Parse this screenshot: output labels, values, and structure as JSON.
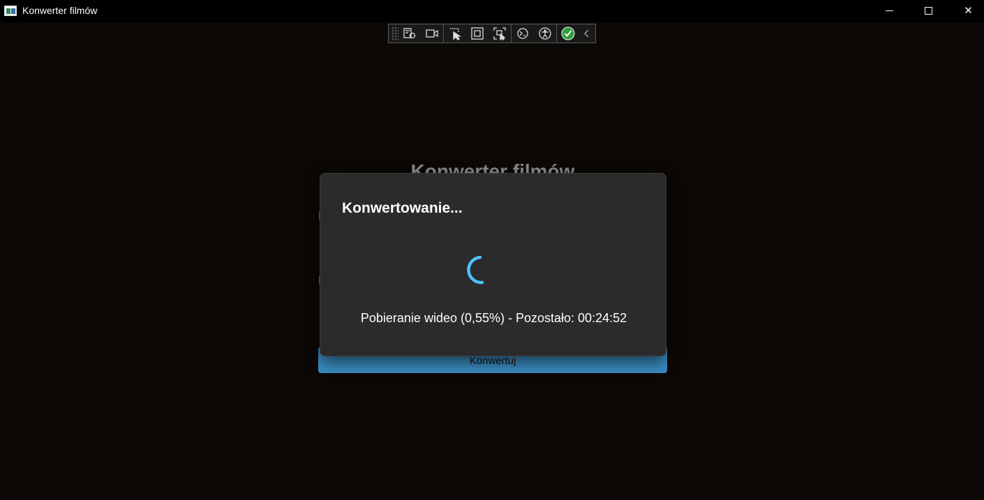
{
  "window": {
    "title": "Konwerter filmów",
    "controls": {
      "minimize": "minimize",
      "maximize": "maximize",
      "close": "✕"
    }
  },
  "dev_toolbar": {
    "icons": [
      "live-visual-tree-icon",
      "video-record-icon",
      "select-element-icon",
      "display-layout-adorners-icon",
      "track-focus-icon",
      "hot-reload-icon",
      "accessibility-icon",
      "binding-check-icon",
      "collapse-chevron-icon"
    ]
  },
  "background": {
    "heading": "Konwerter filmów",
    "convert_button": "Konwertuj",
    "accent_color": "#3a8cc2"
  },
  "dialog": {
    "title": "Konwertowanie...",
    "status": "Pobieranie wideo (0,55%) - Pozostało: 00:24:52",
    "progress_percent": 0.55,
    "spinner_color": "#4cc2ff"
  }
}
